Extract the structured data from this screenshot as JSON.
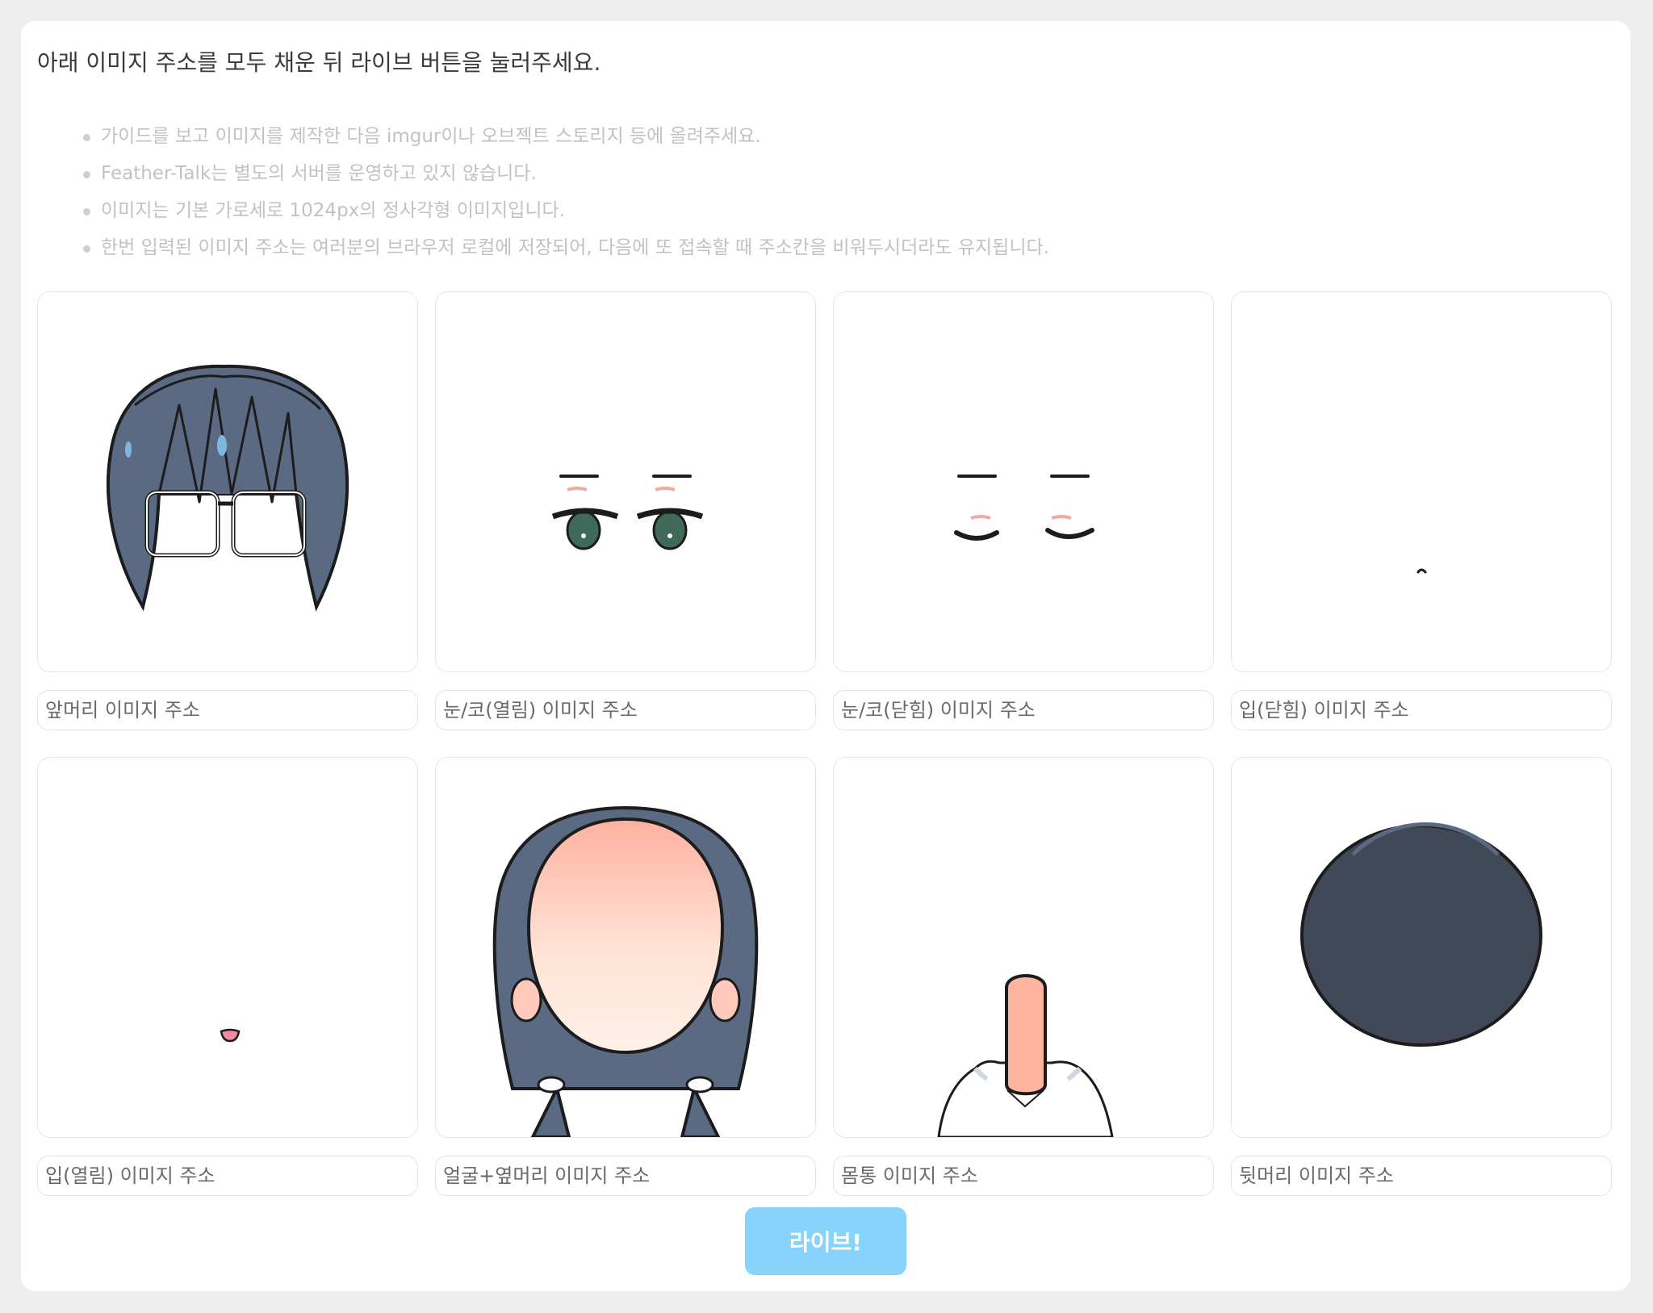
{
  "instruction": "아래 이미지 주소를 모두 채운 뒤 라이브 버튼을 눌러주세요.",
  "guide_items": [
    "가이드를 보고 이미지를 제작한 다음 imgur이나 오브젝트 스토리지 등에 올려주세요.",
    "Feather-Talk는 별도의 서버를 운영하고 있지 않습니다.",
    "이미지는 기본 가로세로 1024px의 정사각형 이미지입니다.",
    "한번 입력된 이미지 주소는 여러분의 브라우저 로컬에 저장되어, 다음에 또 접속할 때 주소칸을 비워두시더라도 유지됩니다."
  ],
  "slots": [
    {
      "placeholder": "앞머리 이미지 주소",
      "value": ""
    },
    {
      "placeholder": "눈/코(열림) 이미지 주소",
      "value": ""
    },
    {
      "placeholder": "눈/코(닫힘) 이미지 주소",
      "value": ""
    },
    {
      "placeholder": "입(닫힘) 이미지 주소",
      "value": ""
    },
    {
      "placeholder": "입(열림) 이미지 주소",
      "value": ""
    },
    {
      "placeholder": "얼굴+옆머리 이미지 주소",
      "value": ""
    },
    {
      "placeholder": "몸통 이미지 주소",
      "value": ""
    },
    {
      "placeholder": "뒷머리 이미지 주소",
      "value": ""
    }
  ],
  "live_button_label": "라이브!",
  "colors": {
    "hair": "#5a6a82",
    "hair_dark": "#414958",
    "skin": "#ffd0bc",
    "button": "#87d3fb"
  }
}
